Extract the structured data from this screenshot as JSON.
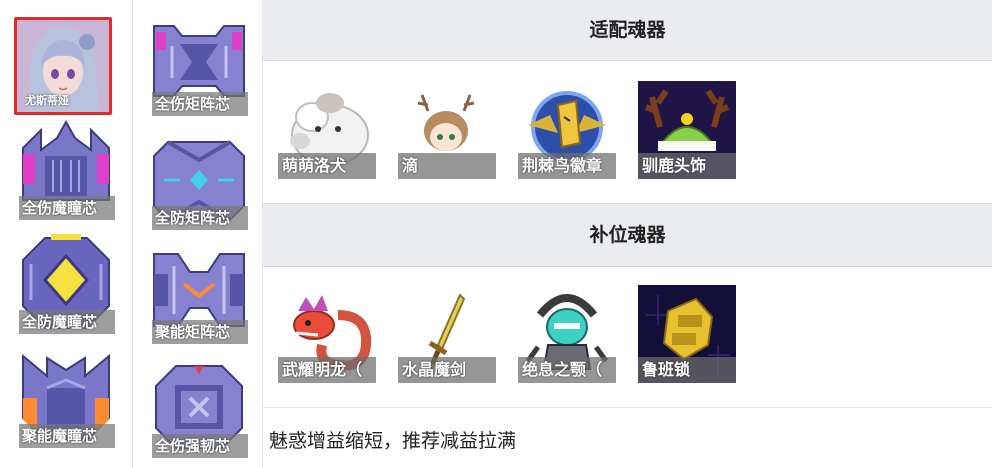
{
  "character": {
    "name": "尤斯蒂娅"
  },
  "left_chips": [
    {
      "label": "全伤魔瞳芯",
      "accent": "#e040c8"
    },
    {
      "label": "全防魔瞳芯",
      "accent": "#f5e040"
    },
    {
      "label": "聚能魔瞳芯",
      "accent": "#ff8a30"
    }
  ],
  "mid_chips": [
    {
      "label": "全伤矩阵芯",
      "accent": "#e040c8"
    },
    {
      "label": "全防矩阵芯",
      "accent": "#40d0f0"
    },
    {
      "label": "聚能矩阵芯",
      "accent": "#ff8a30"
    },
    {
      "label": "全伤强韧芯",
      "accent": "#e04060"
    }
  ],
  "sections": {
    "fit_title": "适配魂器",
    "fill_title": "补位魂器"
  },
  "fit_souls": [
    {
      "label": "萌萌洛犬",
      "icon": "fluffy-dog-icon"
    },
    {
      "label": "滴",
      "icon": "deer-girl-icon"
    },
    {
      "label": "荆棘鸟徽章",
      "icon": "bird-badge-icon"
    },
    {
      "label": "驯鹿头饰",
      "icon": "reindeer-hat-icon"
    }
  ],
  "fill_souls": [
    {
      "label": "武耀明龙（",
      "icon": "dragon-icon"
    },
    {
      "label": "水晶魔剑",
      "icon": "crystal-sword-icon"
    },
    {
      "label": "绝息之颚（",
      "icon": "mech-skull-icon"
    },
    {
      "label": "鲁班锁",
      "icon": "burr-puzzle-icon"
    }
  ],
  "note": "魅惑增益缩短，推荐减益拉满"
}
